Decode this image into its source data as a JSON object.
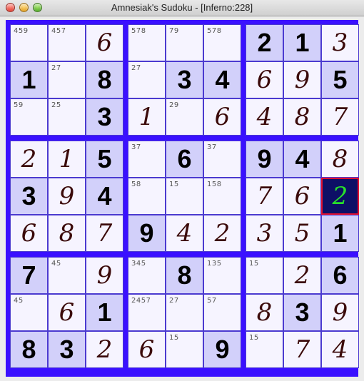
{
  "window": {
    "title": "Amnesiak's Sudoku - [Inferno:228]"
  },
  "colors": {
    "grid": "#3a10ff",
    "cell": "#f6f4ff",
    "shaded": "#d2d0fa",
    "selected": "#0d0f66",
    "selected_border": "#e01030",
    "selected_digit": "#28e02a"
  },
  "board": {
    "cells": [
      [
        {
          "c": "459"
        },
        {
          "c": "457"
        },
        {
          "v": "6",
          "t": "hand"
        },
        {
          "c": "578"
        },
        {
          "c": "79"
        },
        {
          "c": "578"
        },
        {
          "v": "2",
          "t": "given",
          "s": 1
        },
        {
          "v": "1",
          "t": "given",
          "s": 1
        },
        {
          "v": "3",
          "t": "hand"
        }
      ],
      [
        {
          "v": "1",
          "t": "given",
          "s": 1
        },
        {
          "c": "27"
        },
        {
          "v": "8",
          "t": "given",
          "s": 1
        },
        {
          "c": "27"
        },
        {
          "v": "3",
          "t": "given",
          "s": 1
        },
        {
          "v": "4",
          "t": "given",
          "s": 1
        },
        {
          "v": "6",
          "t": "hand"
        },
        {
          "v": "9",
          "t": "hand"
        },
        {
          "v": "5",
          "t": "given",
          "s": 1
        }
      ],
      [
        {
          "c": "59"
        },
        {
          "c": "25"
        },
        {
          "v": "3",
          "t": "given",
          "s": 1
        },
        {
          "v": "1",
          "t": "hand"
        },
        {
          "c": "29"
        },
        {
          "v": "6",
          "t": "hand"
        },
        {
          "v": "4",
          "t": "hand"
        },
        {
          "v": "8",
          "t": "hand"
        },
        {
          "v": "7",
          "t": "hand"
        }
      ],
      [
        {
          "v": "2",
          "t": "hand"
        },
        {
          "v": "1",
          "t": "hand"
        },
        {
          "v": "5",
          "t": "given",
          "s": 1
        },
        {
          "c": "37"
        },
        {
          "v": "6",
          "t": "given",
          "s": 1
        },
        {
          "c": "37"
        },
        {
          "v": "9",
          "t": "given",
          "s": 1
        },
        {
          "v": "4",
          "t": "given",
          "s": 1
        },
        {
          "v": "8",
          "t": "hand"
        }
      ],
      [
        {
          "v": "3",
          "t": "given",
          "s": 1
        },
        {
          "v": "9",
          "t": "hand"
        },
        {
          "v": "4",
          "t": "given",
          "s": 1
        },
        {
          "c": "58"
        },
        {
          "c": "15"
        },
        {
          "c": "158"
        },
        {
          "v": "7",
          "t": "hand"
        },
        {
          "v": "6",
          "t": "hand"
        },
        {
          "v": "2",
          "t": "hand",
          "sel": 1
        }
      ],
      [
        {
          "v": "6",
          "t": "hand"
        },
        {
          "v": "8",
          "t": "hand"
        },
        {
          "v": "7",
          "t": "hand"
        },
        {
          "v": "9",
          "t": "given",
          "s": 1
        },
        {
          "v": "4",
          "t": "hand"
        },
        {
          "v": "2",
          "t": "hand"
        },
        {
          "v": "3",
          "t": "hand"
        },
        {
          "v": "5",
          "t": "hand"
        },
        {
          "v": "1",
          "t": "given",
          "s": 1
        }
      ],
      [
        {
          "v": "7",
          "t": "given",
          "s": 1
        },
        {
          "c": "45"
        },
        {
          "v": "9",
          "t": "hand"
        },
        {
          "c": "345"
        },
        {
          "v": "8",
          "t": "given",
          "s": 1
        },
        {
          "c": "135"
        },
        {
          "c": "15"
        },
        {
          "v": "2",
          "t": "hand"
        },
        {
          "v": "6",
          "t": "given",
          "s": 1
        }
      ],
      [
        {
          "c": "45"
        },
        {
          "v": "6",
          "t": "hand"
        },
        {
          "v": "1",
          "t": "given",
          "s": 1
        },
        {
          "c": "2457"
        },
        {
          "c": "27"
        },
        {
          "c": "57"
        },
        {
          "v": "8",
          "t": "hand"
        },
        {
          "v": "3",
          "t": "given",
          "s": 1
        },
        {
          "v": "9",
          "t": "hand"
        }
      ],
      [
        {
          "v": "8",
          "t": "given",
          "s": 1
        },
        {
          "v": "3",
          "t": "given",
          "s": 1
        },
        {
          "v": "2",
          "t": "hand"
        },
        {
          "v": "6",
          "t": "hand"
        },
        {
          "c": "15"
        },
        {
          "v": "9",
          "t": "given",
          "s": 1
        },
        {
          "c": "15"
        },
        {
          "v": "7",
          "t": "hand"
        },
        {
          "v": "4",
          "t": "hand"
        }
      ]
    ]
  }
}
